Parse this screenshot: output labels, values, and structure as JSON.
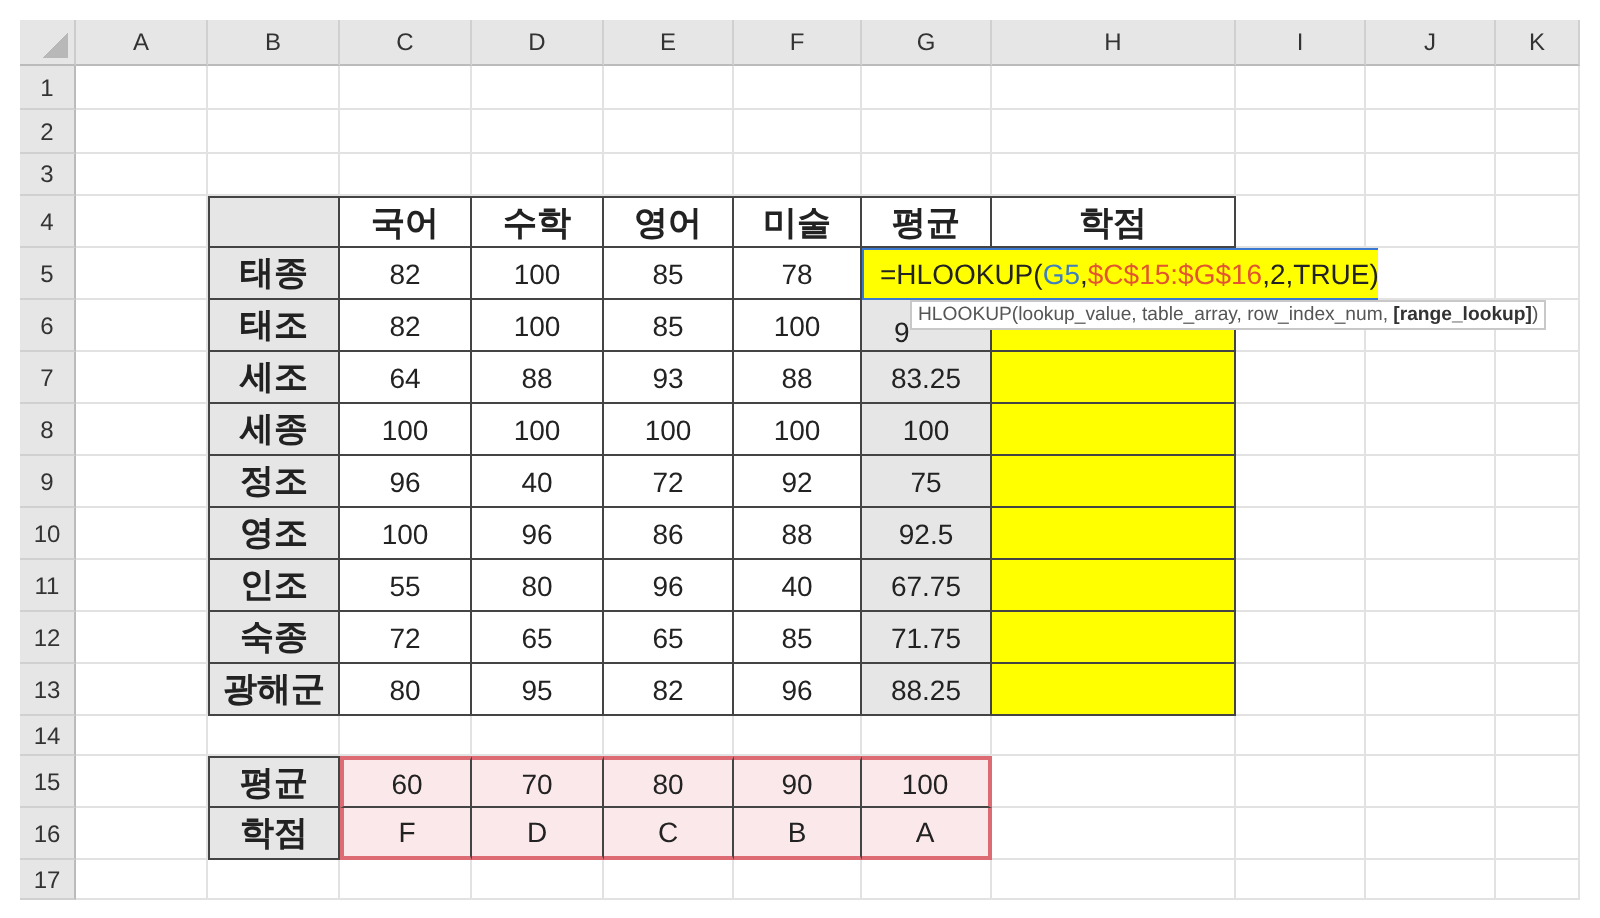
{
  "column_headers": [
    "A",
    "B",
    "C",
    "D",
    "E",
    "F",
    "G",
    "H",
    "I",
    "J",
    "K"
  ],
  "row_headers": [
    "1",
    "2",
    "3",
    "4",
    "5",
    "6",
    "7",
    "8",
    "9",
    "10",
    "11",
    "12",
    "13",
    "14",
    "15",
    "16",
    "17"
  ],
  "score_table": {
    "header": [
      "국어",
      "수학",
      "영어",
      "미술",
      "평균",
      "학점"
    ],
    "rows": [
      {
        "name": "태종",
        "cells": [
          "82",
          "100",
          "85",
          "78"
        ]
      },
      {
        "name": "태조",
        "cells": [
          "82",
          "100",
          "85",
          "100",
          "9"
        ]
      },
      {
        "name": "세조",
        "cells": [
          "64",
          "88",
          "93",
          "88",
          "83.25"
        ]
      },
      {
        "name": "세종",
        "cells": [
          "100",
          "100",
          "100",
          "100",
          "100"
        ]
      },
      {
        "name": "정조",
        "cells": [
          "96",
          "40",
          "72",
          "92",
          "75"
        ]
      },
      {
        "name": "영조",
        "cells": [
          "100",
          "96",
          "86",
          "88",
          "92.5"
        ]
      },
      {
        "name": "인조",
        "cells": [
          "55",
          "80",
          "96",
          "40",
          "67.75"
        ]
      },
      {
        "name": "숙종",
        "cells": [
          "72",
          "65",
          "65",
          "85",
          "71.75"
        ]
      },
      {
        "name": "광해군",
        "cells": [
          "80",
          "95",
          "82",
          "96",
          "88.25"
        ]
      }
    ]
  },
  "formula_editor": {
    "prefix": "=HLOOKUP(",
    "references": [
      {
        "text": "G5",
        "color": "#3f7fbf",
        "suffix": ","
      },
      {
        "text": "$C$15:$G$16",
        "color": "#e2552f",
        "suffix": ",2,TRUE)"
      }
    ]
  },
  "function_tooltip": {
    "text": "HLOOKUP(lookup_value, table_array, row_index_num, **[range_lookup]**)"
  },
  "lookup_table": {
    "rows": [
      {
        "label": "평균",
        "cells": [
          "60",
          "70",
          "80",
          "90",
          "100"
        ]
      },
      {
        "label": "학점",
        "cells": [
          "F",
          "D",
          "C",
          "B",
          "A"
        ]
      }
    ]
  }
}
